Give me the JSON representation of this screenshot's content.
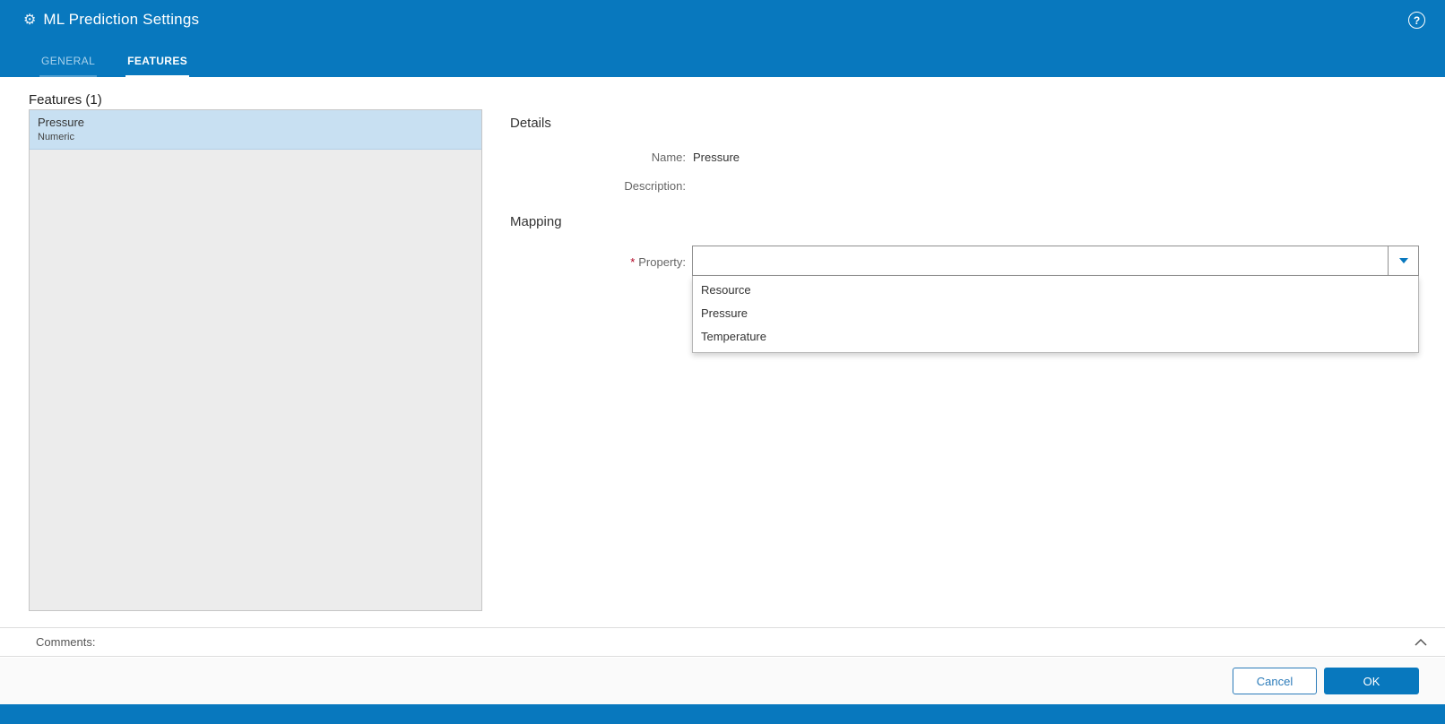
{
  "header": {
    "title": "ML Prediction Settings",
    "help_icon": "?",
    "gear_icon": "⚙",
    "tabs": [
      {
        "label": "GENERAL",
        "active": false
      },
      {
        "label": "FEATURES",
        "active": true
      }
    ]
  },
  "features_panel": {
    "title": "Features (1)",
    "items": [
      {
        "name": "Pressure",
        "type": "Numeric",
        "selected": true
      }
    ]
  },
  "details": {
    "section_title": "Details",
    "name_label": "Name:",
    "name_value": "Pressure",
    "description_label": "Description:",
    "description_value": ""
  },
  "mapping": {
    "section_title": "Mapping",
    "required_marker": "*",
    "property_label": "Property:",
    "selected_value": "",
    "options": [
      "Resource",
      "Pressure",
      "Temperature"
    ]
  },
  "comments": {
    "label": "Comments:"
  },
  "footer": {
    "cancel_label": "Cancel",
    "ok_label": "OK"
  },
  "colors": {
    "header_blue": "#0878be",
    "accent_blue": "#0878be",
    "selected_item_bg": "#c8e0f2",
    "list_bg": "#ececec",
    "required_red": "#b00020"
  }
}
